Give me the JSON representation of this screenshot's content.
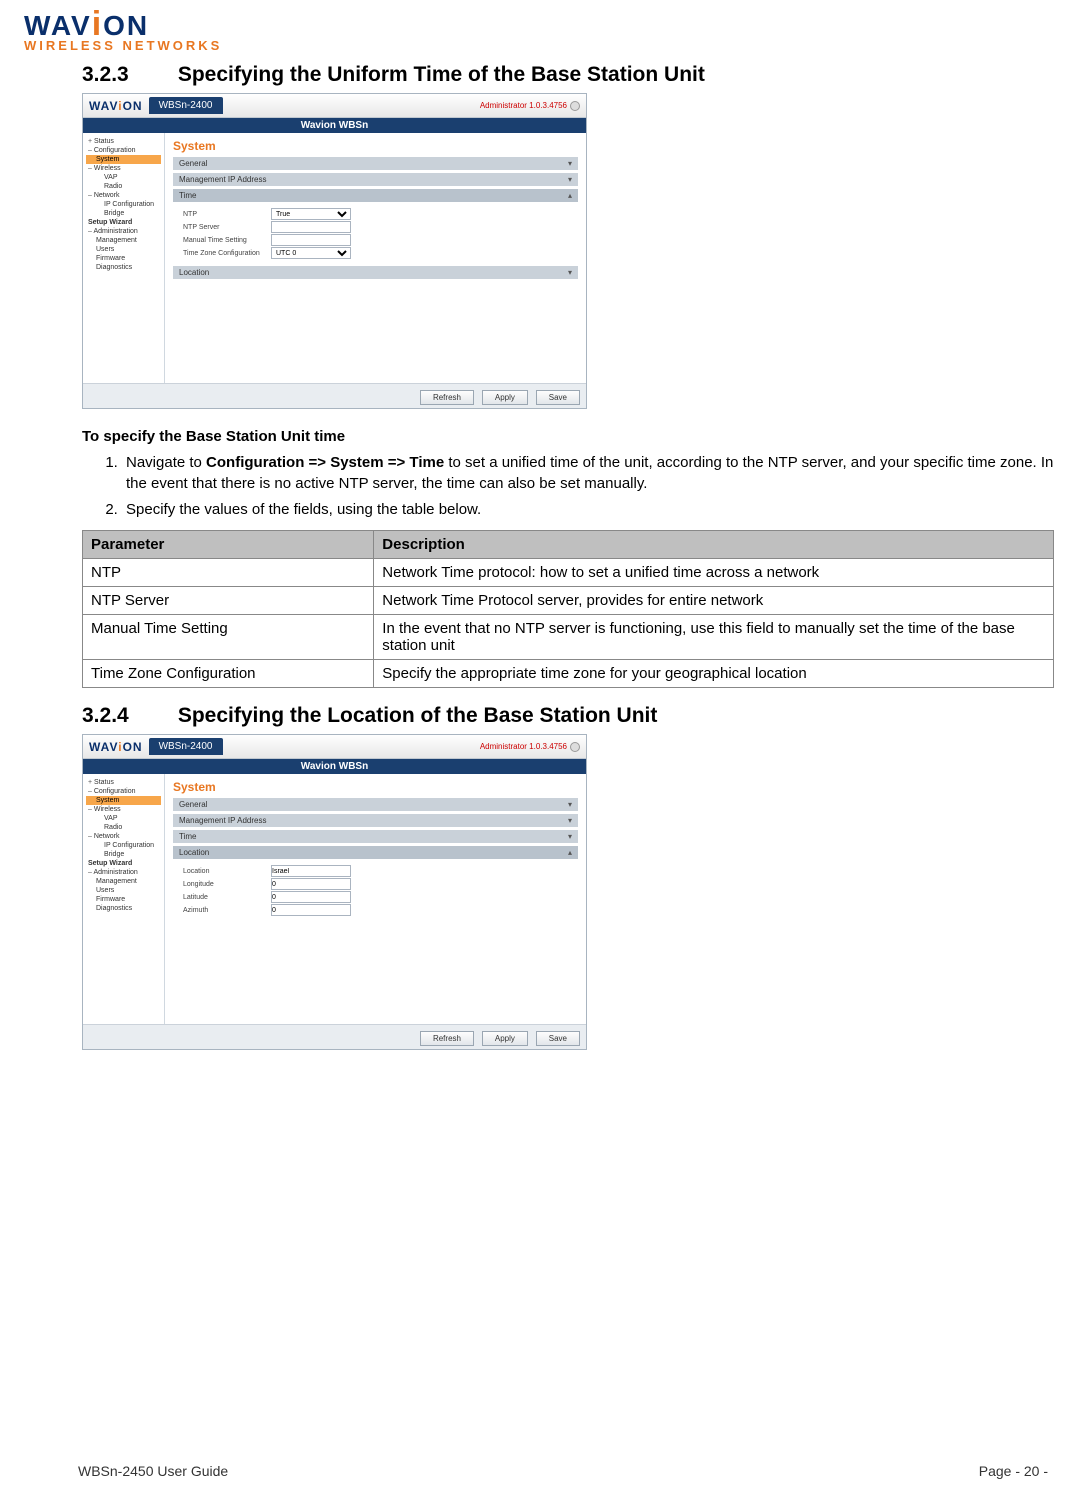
{
  "logo": {
    "brand_pre": "WAV",
    "brand_post": "ON",
    "tagline": "WIRELESS NETWORKS"
  },
  "sections": {
    "s1": {
      "num": "3.2.3",
      "title": "Specifying the Uniform Time of the Base Station Unit"
    },
    "s2": {
      "num": "3.2.4",
      "title": "Specifying the Location of the Base Station Unit"
    }
  },
  "intro_lead": "To specify the Base Station Unit time",
  "steps": {
    "s1_pre": "Navigate to ",
    "s1_bold": "Configuration => System => Time",
    "s1_post": " to set a unified time of the unit, according to the NTP server, and your specific time zone. In the event that there is no active NTP server, the time can also be set manually.",
    "s2": "Specify the values of the fields, using the table below."
  },
  "table": {
    "h1": "Parameter",
    "h2": "Description",
    "rows": [
      {
        "p": "NTP",
        "d": "Network Time protocol: how to set a unified time across a network"
      },
      {
        "p": "NTP Server",
        "d": "Network Time Protocol server, provides for entire network"
      },
      {
        "p": "Manual Time Setting",
        "d": "In the event that no NTP server is functioning, use this field to manually set the time of the base station unit"
      },
      {
        "p": "Time Zone Configuration",
        "d": "Specify the appropriate time zone for your geographical location"
      }
    ]
  },
  "ss_common": {
    "brand_pre": "WAV",
    "brand_post": "ON",
    "tab": "WBSn-2400",
    "admin": "Administrator 1.0.3.4756",
    "title": "Wavion WBSn",
    "heading": "System",
    "btn_refresh": "Refresh",
    "btn_apply": "Apply",
    "btn_save": "Save",
    "side": {
      "status": "Status",
      "config": "Configuration",
      "system": "System",
      "wireless": "Wireless",
      "vap": "VAP",
      "radio": "Radio",
      "network": "Network",
      "ipconf": "IP Configuration",
      "bridge": "Bridge",
      "setup": "Setup Wizard",
      "admin": "Administration",
      "mgmt": "Management",
      "users": "Users",
      "fw": "Firmware",
      "diag": "Diagnostics"
    },
    "bars": {
      "general": "General",
      "mgmt_ip": "Management IP Address",
      "time": "Time",
      "location": "Location"
    }
  },
  "ss_time": {
    "f1": "NTP",
    "f1_val": "True",
    "f2": "NTP Server",
    "f3": "Manual Time Setting",
    "f4": "Time Zone Configuration",
    "f4_val": "UTC 0"
  },
  "ss_loc": {
    "f1": "Location",
    "f1_val": "Israel",
    "f2": "Longitude",
    "f2_val": "0",
    "f3": "Latitude",
    "f3_val": "0",
    "f4": "Azimuth",
    "f4_val": "0"
  },
  "footer": {
    "left": "WBSn-2450 User Guide",
    "right": "Page - 20 -"
  }
}
